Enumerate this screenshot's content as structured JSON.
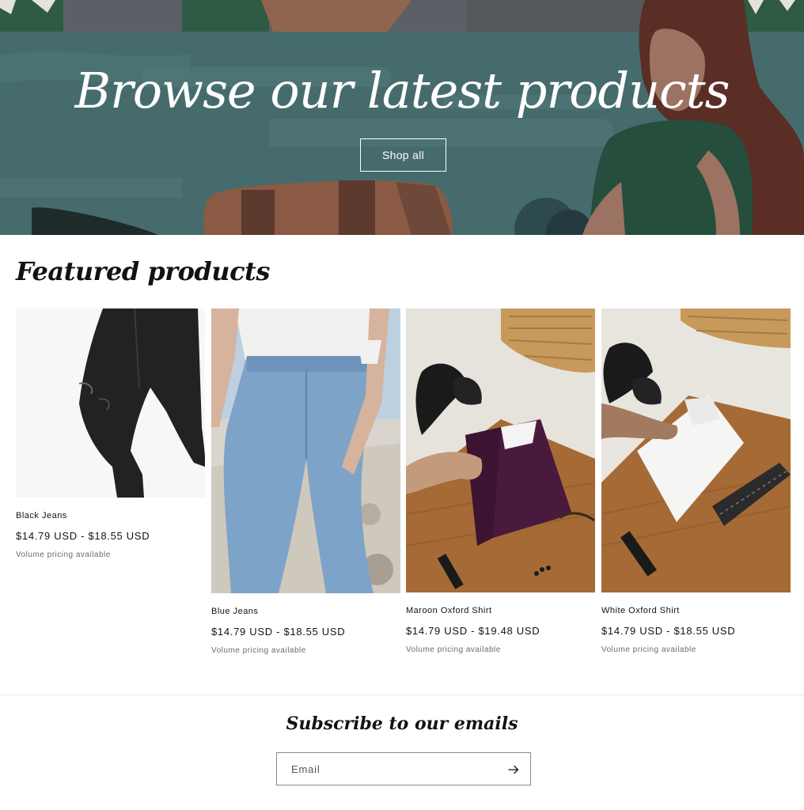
{
  "hero": {
    "title": "Browse our latest products",
    "button_label": "Shop all"
  },
  "featured": {
    "title": "Featured products",
    "products": [
      {
        "name": "Black Jeans",
        "price": "$14.79 USD - $18.55 USD",
        "note": "Volume pricing available"
      },
      {
        "name": "Blue Jeans",
        "price": "$14.79 USD - $18.55 USD",
        "note": "Volume pricing available"
      },
      {
        "name": "Maroon Oxford Shirt",
        "price": "$14.79 USD - $19.48 USD",
        "note": "Volume pricing available"
      },
      {
        "name": "White Oxford Shirt",
        "price": "$14.79 USD - $18.55 USD",
        "note": "Volume pricing available"
      }
    ]
  },
  "newsletter": {
    "title": "Subscribe to our emails",
    "email_placeholder": "Email",
    "submit_icon": "arrow-right-icon"
  }
}
